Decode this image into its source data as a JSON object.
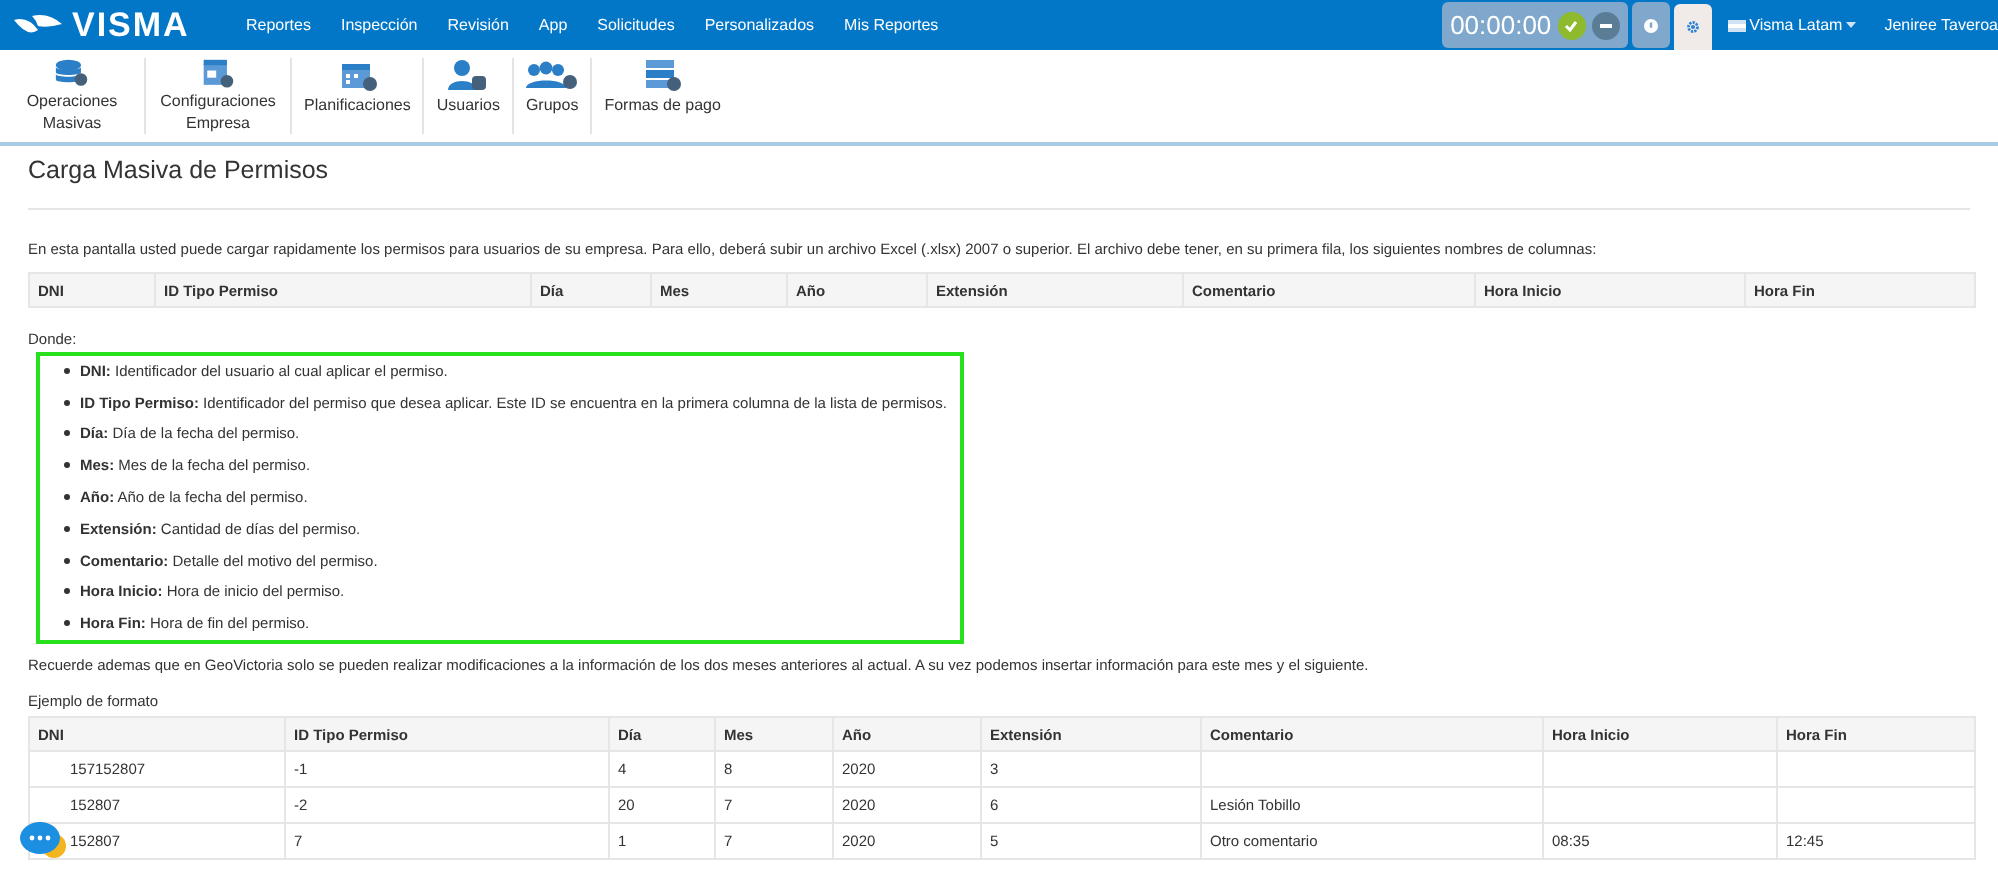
{
  "navbar": {
    "logo": "VISMA",
    "menu": [
      "Reportes",
      "Inspección",
      "Revisión",
      "App",
      "Solicitudes",
      "Personalizados",
      "Mis Reportes"
    ],
    "timer": "00:00:00",
    "company": "Visma Latam",
    "user": "Jeniree Taveroa"
  },
  "toolbar": [
    "Operaciones Masivas",
    "Configuraciones Empresa",
    "Planificaciones",
    "Usuarios",
    "Grupos",
    "Formas de pago"
  ],
  "page_title": "Carga Masiva de Permisos",
  "intro": "En esta pantalla usted puede cargar rapidamente los permisos para usuarios de su empresa. Para ello, deberá subir un archivo Excel (.xlsx) 2007 o superior. El archivo debe tener, en su primera fila, los siguientes nombres de columnas:",
  "columns_table": {
    "columns": [
      "DNI",
      "ID Tipo Permiso",
      "Día",
      "Mes",
      "Año",
      "Extensión",
      "Comentario",
      "Hora Inicio",
      "Hora Fin"
    ]
  },
  "where_label": "Donde:",
  "definitions": [
    "**DNI:** Identificador del usuario al cual aplicar el permiso.",
    "**ID Tipo Permiso:** Identificador del permiso que desea aplicar. Este ID se encuentra en la primera columna de la lista de permisos.",
    "**Día:** Día de la fecha del permiso.",
    "**Mes:** Mes de la fecha del permiso.",
    "**Año:** Año de la fecha del permiso.",
    "**Extensión:** Cantidad de días del permiso.",
    "**Comentario:** Detalle del motivo del permiso.",
    "**Hora Inicio:** Hora de inicio del permiso.",
    "**Hora Fin:** Hora de fin del permiso."
  ],
  "reminder": "Recuerde ademas que en GeoVictoria solo se pueden realizar modificaciones a la información de los dos meses anteriores al actual. A su vez podemos insertar información para este mes y el siguiente.",
  "example_label": "Ejemplo de formato",
  "example_table": {
    "columns": [
      "DNI",
      "ID Tipo Permiso",
      "Día",
      "Mes",
      "Año",
      "Extensión",
      "Comentario",
      "Hora Inicio",
      "Hora Fin"
    ],
    "rows": [
      [
        "157152807",
        "-1",
        "4",
        "8",
        "2020",
        "3",
        "",
        "",
        ""
      ],
      [
        "152807",
        "-2",
        "20",
        "7",
        "2020",
        "6",
        "Lesión Tobillo",
        "",
        ""
      ],
      [
        "152807",
        "7",
        "1",
        "7",
        "2020",
        "5",
        "Otro comentario",
        "08:35",
        "12:45"
      ]
    ]
  }
}
